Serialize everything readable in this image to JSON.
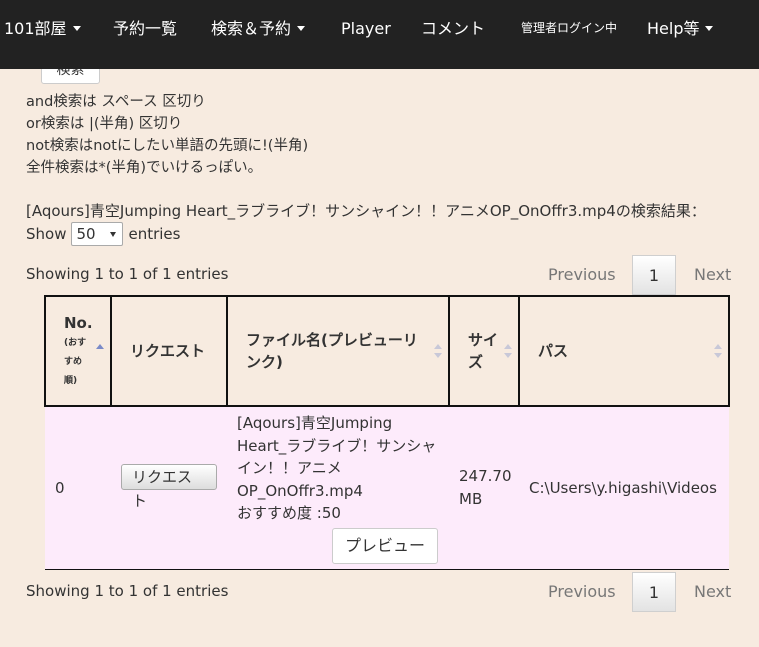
{
  "nav": {
    "items": [
      {
        "label": "101部屋",
        "dropdown": true
      },
      {
        "label": "予約一覧",
        "dropdown": false
      },
      {
        "label": "検索＆予約",
        "dropdown": true
      },
      {
        "label": "Player",
        "dropdown": false
      },
      {
        "label": "コメント",
        "dropdown": false
      },
      {
        "label": "管理者ログイン中",
        "dropdown": false
      },
      {
        "label": "Help等",
        "dropdown": true
      }
    ]
  },
  "search": {
    "button_label": "検索",
    "help_lines": [
      "and検索は スペース 区切り",
      "or検索は |(半角) 区切り",
      "not検索はnotにしたい単語の先頭に!(半角)",
      "全件検索は*(半角)でいけるっぽい。"
    ]
  },
  "results": {
    "title": "[Aqours]青空Jumping Heart_ラブライブ！サンシャイン！！アニメOP_OnOffr3.mp4の検索結果：",
    "show_prefix": "Show",
    "show_value": "50",
    "show_suffix": "entries",
    "info_top": "Showing 1 to 1 of 1 entries",
    "info_bottom": "Showing 1 to 1 of 1 entries",
    "pagination": {
      "previous": "Previous",
      "current_page": "1",
      "next": "Next"
    },
    "columns": [
      {
        "label": "No.",
        "sub": "(おすすめ順)"
      },
      {
        "label": "リクエスト"
      },
      {
        "label": "ファイル名(プレビューリンク)"
      },
      {
        "label": "サイズ"
      },
      {
        "label": "パス"
      }
    ],
    "rows": [
      {
        "no": "0",
        "request_label": "リクエスト",
        "filename": "[Aqours]青空Jumping Heart_ラブライブ！サンシャイン！！アニメOP_OnOffr3.mp4",
        "recommend": "おすすめ度 :50",
        "preview_label": "プレビュー",
        "size": "247.70 MB",
        "path": "C:\\Users\\y.higashi\\Videos"
      }
    ]
  },
  "colors": {
    "navbar": "#222222",
    "page_bg": "#f7ebe0",
    "row_bg": "#fdebfb"
  }
}
